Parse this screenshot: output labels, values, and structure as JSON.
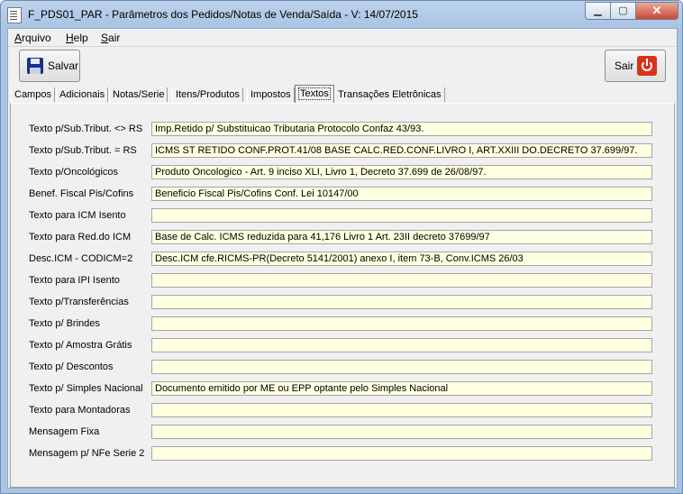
{
  "window": {
    "title": "F_PDS01_PAR - Parâmetros dos Pedidos/Notas de Venda/Saída - V: 14/07/2015",
    "minimize": "▁",
    "maximize": "▢",
    "close": "✕"
  },
  "menu": [
    {
      "ul": "A",
      "rest": "rquivo"
    },
    {
      "ul": "H",
      "rest": "elp"
    },
    {
      "ul": "S",
      "rest": "air"
    }
  ],
  "toolbar": {
    "save_label": "Salvar",
    "exit_label": "Sair",
    "save_icon": "floppy-disk-icon",
    "exit_icon": "power-icon"
  },
  "tabs": [
    "Campos",
    "Adicionais",
    "Notas/Serie",
    "Itens/Produtos",
    "Impostos",
    "Textos",
    "Transações Eletrônicas"
  ],
  "active_tab": "Textos",
  "fields": [
    {
      "label": "Texto p/Sub.Tribut. <> RS",
      "value": "Imp.Retido p/ Substituicao Tributaria Protocolo Confaz 43/93."
    },
    {
      "label": "Texto p/Sub.Tribut. = RS",
      "value": "ICMS ST RETIDO CONF.PROT.41/08 BASE CALC.RED.CONF.LIVRO I, ART.XXIII DO.DECRETO 37.699/97."
    },
    {
      "label": "Texto p/Oncológicos",
      "value": "Produto Oncologico - Art. 9 inciso XLI, Livro 1, Decreto 37.699 de 26/08/97."
    },
    {
      "label": "Benef. Fiscal Pis/Cofins",
      "value": "Beneficio Fiscal Pis/Cofins Conf. Lei 10147/00"
    },
    {
      "label": "Texto para ICM Isento",
      "value": ""
    },
    {
      "label": "Texto para Red.do ICM",
      "value": "Base de Calc. ICMS reduzida para 41,176 Livro 1 Art. 23II decreto 37699/97"
    },
    {
      "label": "Desc.ICM - CODICM=2",
      "value": "Desc.ICM cfe.RICMS-PR(Decreto 5141/2001) anexo I, item 73-B, Conv.ICMS 26/03"
    },
    {
      "label": "Texto para IPI Isento",
      "value": ""
    },
    {
      "label": "Texto p/Transferências",
      "value": ""
    },
    {
      "label": "Texto p/ Brindes",
      "value": ""
    },
    {
      "label": "Texto p/ Amostra Grátis",
      "value": ""
    },
    {
      "label": "Texto p/ Descontos",
      "value": ""
    },
    {
      "label": "Texto p/ Simples Nacional",
      "value": "Documento emitido por ME ou EPP optante pelo Simples Nacional"
    },
    {
      "label": "Texto para Montadoras",
      "value": ""
    },
    {
      "label": "Mensagem Fixa",
      "value": ""
    },
    {
      "label": "Mensagem p/ NFe Serie 2",
      "value": ""
    }
  ]
}
